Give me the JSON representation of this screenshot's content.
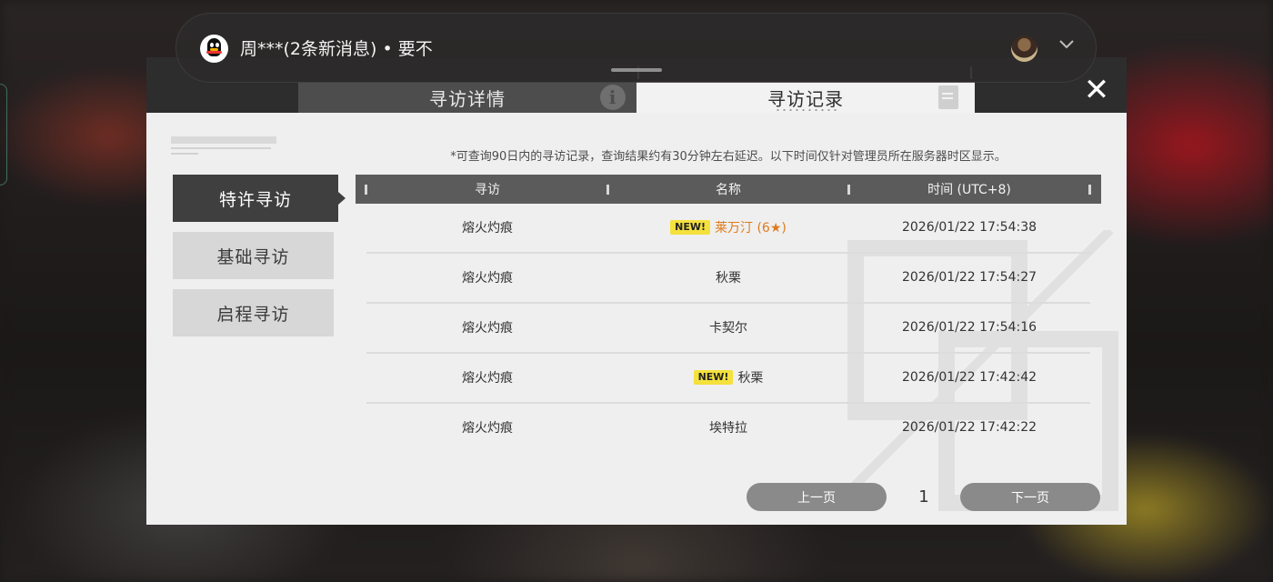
{
  "notification": {
    "app_icon": "qq-penguin-icon",
    "text": "周***(2条新消息) • 要不",
    "avatar": "user-avatar",
    "expand_icon": "chevron-down-icon"
  },
  "dialog": {
    "tabs": [
      {
        "label": "寻访详情",
        "icon": "info-icon",
        "active": false
      },
      {
        "label": "寻访记录",
        "icon": "document-icon",
        "active": true
      }
    ],
    "close_icon": "close-icon",
    "close_glyph": "✕",
    "info_glyph": "i"
  },
  "sidebar": {
    "items": [
      {
        "label": "特许寻访",
        "active": true
      },
      {
        "label": "基础寻访",
        "active": false
      },
      {
        "label": "启程寻访",
        "active": false
      }
    ]
  },
  "notice": "*可查询90日内的寻访记录，查询结果约有30分钟左右延迟。以下时间仅针对管理员所在服务器时区显示。",
  "table": {
    "headers": [
      "寻访",
      "名称",
      "时间 (UTC+8)"
    ],
    "rows": [
      {
        "pool": "熔火灼痕",
        "badge": "NEW!",
        "name": "莱万汀 (6★)",
        "rare": true,
        "time": "2026/01/22 17:54:38"
      },
      {
        "pool": "熔火灼痕",
        "badge": "",
        "name": "秋栗",
        "rare": false,
        "time": "2026/01/22 17:54:27"
      },
      {
        "pool": "熔火灼痕",
        "badge": "",
        "name": "卡契尔",
        "rare": false,
        "time": "2026/01/22 17:54:16"
      },
      {
        "pool": "熔火灼痕",
        "badge": "NEW!",
        "name": "秋栗",
        "rare": false,
        "time": "2026/01/22 17:42:42"
      },
      {
        "pool": "熔火灼痕",
        "badge": "",
        "name": "埃特拉",
        "rare": false,
        "time": "2026/01/22 17:42:22"
      }
    ]
  },
  "pagination": {
    "prev_label": "上一页",
    "current_page": "1",
    "next_label": "下一页"
  },
  "colors": {
    "accent_badge": "#f4e13c",
    "rare_text": "#e07a1a",
    "header_dark": "#2d2d2d",
    "table_head": "#5b5b5b"
  }
}
